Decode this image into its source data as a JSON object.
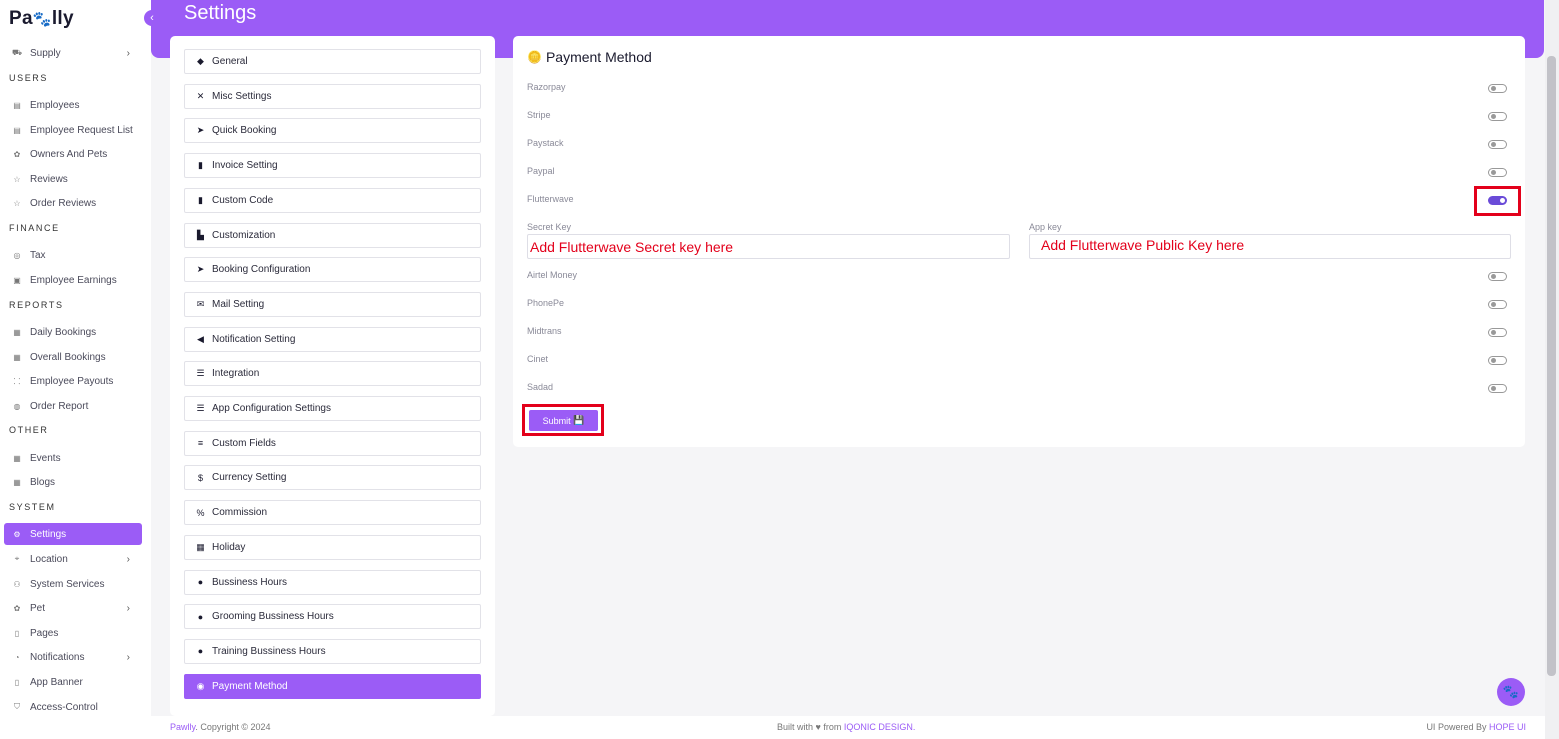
{
  "brand": {
    "logo_start": "Pa",
    "logo_end": "lly",
    "collapse_icon": "chevron-left-icon"
  },
  "sidebar": {
    "items": [
      {
        "label": "Supply",
        "icon": "truck-icon",
        "chevron": true
      },
      {
        "section": "USERS"
      },
      {
        "label": "Employees",
        "icon": "card-icon"
      },
      {
        "label": "Employee Request List",
        "icon": "card-icon"
      },
      {
        "label": "Owners And Pets",
        "icon": "paw-icon"
      },
      {
        "label": "Reviews",
        "icon": "star-icon"
      },
      {
        "label": "Order Reviews",
        "icon": "star-icon"
      },
      {
        "section": "FINANCE"
      },
      {
        "label": "Tax",
        "icon": "percent-circle-icon"
      },
      {
        "label": "Employee Earnings",
        "icon": "wallet-icon"
      },
      {
        "section": "REPORTS"
      },
      {
        "label": "Daily Bookings",
        "icon": "calendar-icon"
      },
      {
        "label": "Overall Bookings",
        "icon": "calendar-icon"
      },
      {
        "label": "Employee Payouts",
        "icon": "payout-icon"
      },
      {
        "label": "Order Report",
        "icon": "globe-icon"
      },
      {
        "section": "OTHER"
      },
      {
        "label": "Events",
        "icon": "calendar-icon"
      },
      {
        "label": "Blogs",
        "icon": "calendar-icon"
      },
      {
        "section": "SYSTEM"
      },
      {
        "label": "Settings",
        "icon": "gear-icon",
        "active": true
      },
      {
        "label": "Location",
        "icon": "pin-icon",
        "chevron": true
      },
      {
        "label": "System Services",
        "icon": "users-icon"
      },
      {
        "label": "Pet",
        "icon": "paw-icon",
        "chevron": true
      },
      {
        "label": "Pages",
        "icon": "page-icon"
      },
      {
        "label": "Notifications",
        "icon": "bell-icon",
        "chevron": true
      },
      {
        "label": "App Banner",
        "icon": "phone-icon"
      },
      {
        "label": "Access-Control",
        "icon": "shield-icon"
      }
    ]
  },
  "header": {
    "title": "Settings"
  },
  "settings_nav": {
    "items": [
      {
        "label": "General",
        "icon": "cube-icon"
      },
      {
        "label": "Misc Settings",
        "icon": "tools-icon"
      },
      {
        "label": "Quick Booking",
        "icon": "paper-plane-icon"
      },
      {
        "label": "Invoice Setting",
        "icon": "file-icon"
      },
      {
        "label": "Custom Code",
        "icon": "file-code-icon"
      },
      {
        "label": "Customization",
        "icon": "customize-icon"
      },
      {
        "label": "Booking Configuration",
        "icon": "paper-plane-icon"
      },
      {
        "label": "Mail Setting",
        "icon": "envelope-icon"
      },
      {
        "label": "Notification Setting",
        "icon": "megaphone-icon"
      },
      {
        "label": "Integration",
        "icon": "sliders-icon"
      },
      {
        "label": "App Configuration Settings",
        "icon": "sliders-icon"
      },
      {
        "label": "Custom Fields",
        "icon": "list-icon"
      },
      {
        "label": "Currency Setting",
        "icon": "dollar-icon"
      },
      {
        "label": "Commission",
        "icon": "percent-icon"
      },
      {
        "label": "Holiday",
        "icon": "calendar-icon"
      },
      {
        "label": "Bussiness Hours",
        "icon": "clock-icon"
      },
      {
        "label": "Grooming Bussiness Hours",
        "icon": "clock-icon"
      },
      {
        "label": "Training Bussiness Hours",
        "icon": "clock-icon"
      },
      {
        "label": "Payment Method",
        "icon": "coins-icon",
        "active": true
      }
    ]
  },
  "payment": {
    "title": "Payment Method",
    "title_icon": "coins-icon",
    "methods_top": [
      {
        "label": "Razorpay",
        "enabled": false
      },
      {
        "label": "Stripe",
        "enabled": false
      },
      {
        "label": "Paystack",
        "enabled": false
      },
      {
        "label": "Paypal",
        "enabled": false
      },
      {
        "label": "Flutterwave",
        "enabled": true
      }
    ],
    "secret_key_label": "Secret Key",
    "secret_key_value": "Add Flutterwave Secret key here",
    "app_key_label": "App key",
    "app_key_value": "Add Flutterwave Public Key here",
    "methods_bottom": [
      {
        "label": "Airtel Money",
        "enabled": false
      },
      {
        "label": "PhonePe",
        "enabled": false
      },
      {
        "label": "Midtrans",
        "enabled": false
      },
      {
        "label": "Cinet",
        "enabled": false
      },
      {
        "label": "Sadad",
        "enabled": false
      }
    ],
    "submit_label": "Submit",
    "submit_icon": "save-icon"
  },
  "footer": {
    "brand": "Pawlly",
    "copyright": ". Copyright © 2024",
    "built_with": "Built with ♥ from",
    "built_by": "IQONIC DESIGN.",
    "powered_prefix": "UI Powered By",
    "powered_by": "HOPE UI"
  },
  "colors": {
    "accent": "#9b5cf6",
    "highlight": "#e3001b",
    "toggle_on": "#6a4bd8"
  }
}
